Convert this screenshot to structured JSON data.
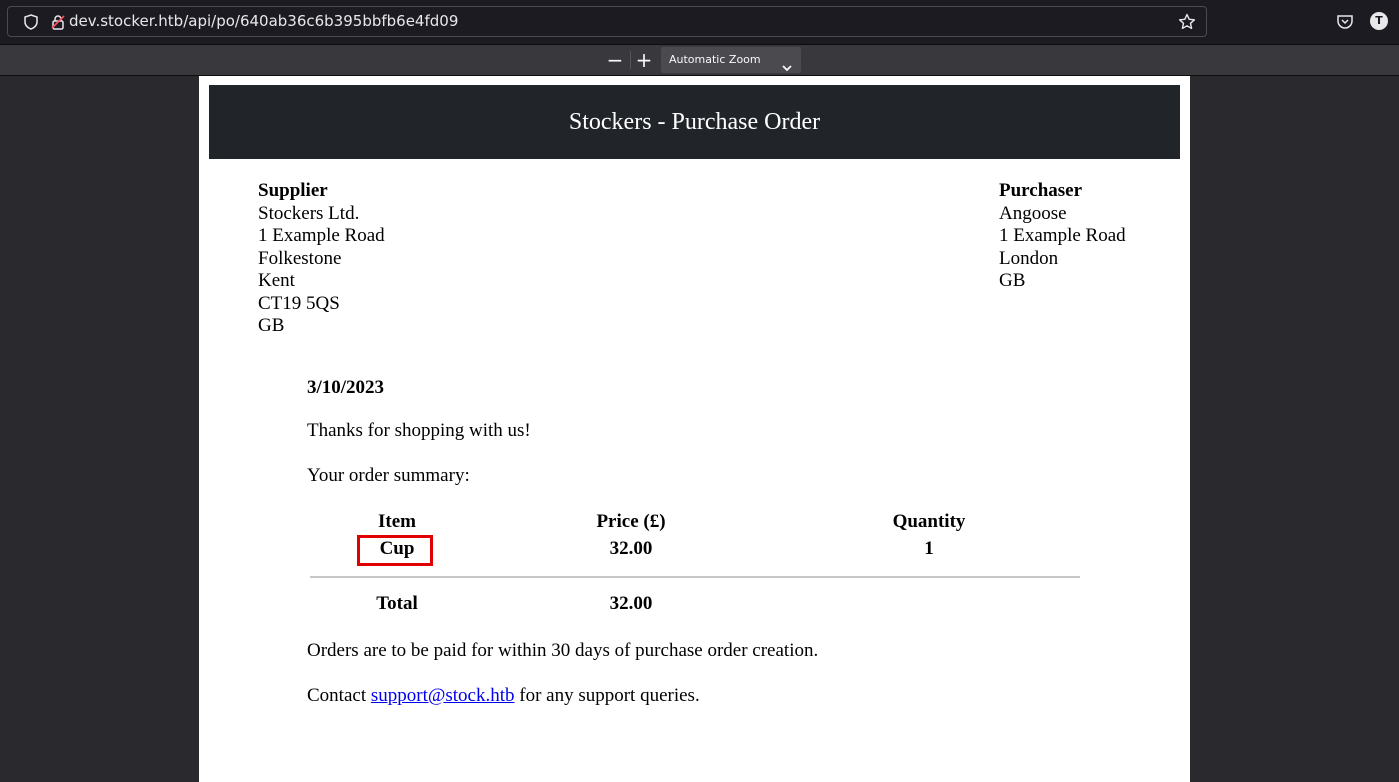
{
  "browser": {
    "url": "dev.stocker.htb/api/po/640ab36c6b395bbfb6e4fd09",
    "account_initial": "T"
  },
  "pdf_toolbar": {
    "zoom_out": "−",
    "zoom_in": "+",
    "zoom_label": "Automatic Zoom"
  },
  "document": {
    "title": "Stockers - Purchase Order",
    "supplier": {
      "label": "Supplier",
      "lines": [
        "Stockers Ltd.",
        "1 Example Road",
        "Folkestone",
        "Kent",
        "CT19 5QS",
        "GB"
      ]
    },
    "purchaser": {
      "label": "Purchaser",
      "lines": [
        "Angoose",
        "1 Example Road",
        "London",
        "GB"
      ]
    },
    "date": "3/10/2023",
    "thanks": "Thanks for shopping with us!",
    "summary_intro": "Your order summary:",
    "table": {
      "headers": [
        "Item",
        "Price (£)",
        "Quantity"
      ],
      "rows": [
        {
          "item": "Cup",
          "price": "32.00",
          "quantity": "1"
        }
      ],
      "total_label": "Total",
      "total_price": "32.00"
    },
    "payment_terms": "Orders are to be paid for within 30 days of purchase order creation.",
    "contact_prefix": "Contact ",
    "contact_email": "support@stock.htb",
    "contact_suffix": " for any support queries."
  },
  "colors": {
    "banner": "#212529",
    "highlight": "#e00000",
    "link": "#0000ee"
  }
}
